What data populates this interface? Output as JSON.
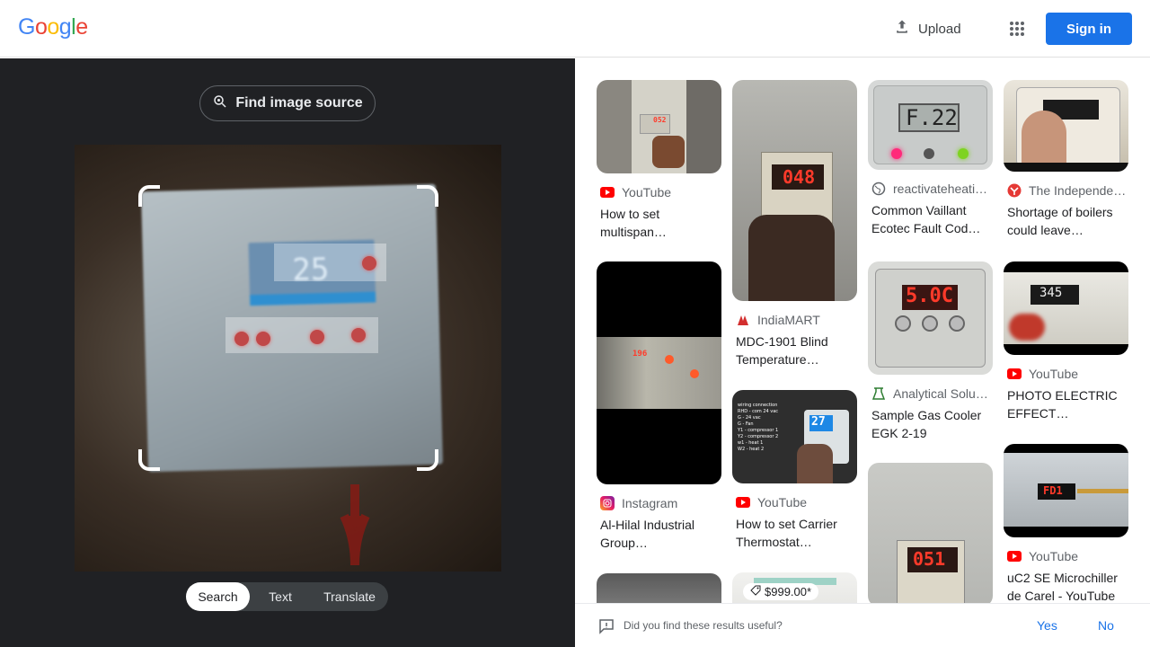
{
  "header": {
    "logo_letters": [
      {
        "char": "G",
        "color": "#4285f4"
      },
      {
        "char": "o",
        "color": "#ea4335"
      },
      {
        "char": "o",
        "color": "#fbbc05"
      },
      {
        "char": "g",
        "color": "#4285f4"
      },
      {
        "char": "l",
        "color": "#34a853"
      },
      {
        "char": "e",
        "color": "#ea4335"
      }
    ],
    "upload_label": "Upload",
    "apps_icon": "apps-grid-icon",
    "signin_label": "Sign in"
  },
  "left_panel": {
    "find_source_label": "Find image source",
    "display_text": "25",
    "modes": [
      "Search",
      "Text",
      "Translate"
    ],
    "active_mode": "Search"
  },
  "results": [
    {
      "source": "YouTube",
      "icon": "youtube-icon",
      "title": "How to set multispan…",
      "thumb_text": "052"
    },
    {
      "source": "IndiaMART",
      "icon": "indiamart-icon",
      "title": "MDC-1901 Blind Temperature…",
      "thumb_text": "048"
    },
    {
      "source": "reactivateheati…",
      "icon": "globe-icon",
      "title": "Common Vaillant Ecotec Fault Cod…",
      "thumb_text": "F.22"
    },
    {
      "source": "The Independe…",
      "icon": "independent-icon",
      "title": "Shortage of boilers could leave…",
      "thumb_text": ""
    },
    {
      "source": "Instagram",
      "icon": "instagram-icon",
      "title": "Al-Hilal Industrial Group…",
      "thumb_text": "196"
    },
    {
      "source": "YouTube",
      "icon": "youtube-icon",
      "title": "How to set Carrier Thermostat…",
      "thumb_text": "27"
    },
    {
      "source": "Analytical Solu…",
      "icon": "analytical-icon",
      "title": "Sample Gas Cooler EGK 2-19",
      "thumb_text": "5.0C"
    },
    {
      "source": "YouTube",
      "icon": "youtube-icon",
      "title": "PHOTO ELECTRIC EFFECT…",
      "thumb_text": "345"
    },
    {
      "source": "YouTube",
      "icon": "youtube-icon",
      "title": "uC2 SE Microchiller de Carel - YouTube",
      "thumb_text": "FD1"
    },
    {
      "source": "",
      "icon": "",
      "title": "",
      "thumb_text": "051"
    },
    {
      "source": "",
      "icon": "",
      "title": "",
      "price": "$999.00*"
    }
  ],
  "feedback": {
    "question": "Did you find these results useful?",
    "yes": "Yes",
    "no": "No"
  }
}
